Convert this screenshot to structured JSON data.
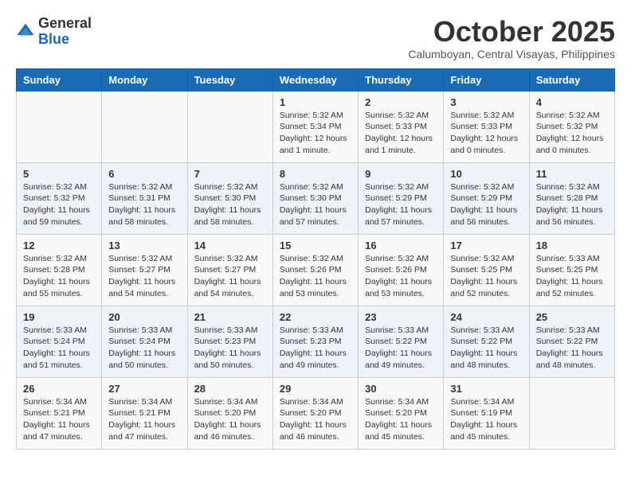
{
  "logo": {
    "general": "General",
    "blue": "Blue"
  },
  "header": {
    "month": "October 2025",
    "location": "Calumboyan, Central Visayas, Philippines"
  },
  "days_of_week": [
    "Sunday",
    "Monday",
    "Tuesday",
    "Wednesday",
    "Thursday",
    "Friday",
    "Saturday"
  ],
  "weeks": [
    [
      {
        "day": "",
        "content": ""
      },
      {
        "day": "",
        "content": ""
      },
      {
        "day": "",
        "content": ""
      },
      {
        "day": "1",
        "content": "Sunrise: 5:32 AM\nSunset: 5:34 PM\nDaylight: 12 hours\nand 1 minute."
      },
      {
        "day": "2",
        "content": "Sunrise: 5:32 AM\nSunset: 5:33 PM\nDaylight: 12 hours\nand 1 minute."
      },
      {
        "day": "3",
        "content": "Sunrise: 5:32 AM\nSunset: 5:33 PM\nDaylight: 12 hours\nand 0 minutes."
      },
      {
        "day": "4",
        "content": "Sunrise: 5:32 AM\nSunset: 5:32 PM\nDaylight: 12 hours\nand 0 minutes."
      }
    ],
    [
      {
        "day": "5",
        "content": "Sunrise: 5:32 AM\nSunset: 5:32 PM\nDaylight: 11 hours\nand 59 minutes."
      },
      {
        "day": "6",
        "content": "Sunrise: 5:32 AM\nSunset: 5:31 PM\nDaylight: 11 hours\nand 58 minutes."
      },
      {
        "day": "7",
        "content": "Sunrise: 5:32 AM\nSunset: 5:30 PM\nDaylight: 11 hours\nand 58 minutes."
      },
      {
        "day": "8",
        "content": "Sunrise: 5:32 AM\nSunset: 5:30 PM\nDaylight: 11 hours\nand 57 minutes."
      },
      {
        "day": "9",
        "content": "Sunrise: 5:32 AM\nSunset: 5:29 PM\nDaylight: 11 hours\nand 57 minutes."
      },
      {
        "day": "10",
        "content": "Sunrise: 5:32 AM\nSunset: 5:29 PM\nDaylight: 11 hours\nand 56 minutes."
      },
      {
        "day": "11",
        "content": "Sunrise: 5:32 AM\nSunset: 5:28 PM\nDaylight: 11 hours\nand 56 minutes."
      }
    ],
    [
      {
        "day": "12",
        "content": "Sunrise: 5:32 AM\nSunset: 5:28 PM\nDaylight: 11 hours\nand 55 minutes."
      },
      {
        "day": "13",
        "content": "Sunrise: 5:32 AM\nSunset: 5:27 PM\nDaylight: 11 hours\nand 54 minutes."
      },
      {
        "day": "14",
        "content": "Sunrise: 5:32 AM\nSunset: 5:27 PM\nDaylight: 11 hours\nand 54 minutes."
      },
      {
        "day": "15",
        "content": "Sunrise: 5:32 AM\nSunset: 5:26 PM\nDaylight: 11 hours\nand 53 minutes."
      },
      {
        "day": "16",
        "content": "Sunrise: 5:32 AM\nSunset: 5:26 PM\nDaylight: 11 hours\nand 53 minutes."
      },
      {
        "day": "17",
        "content": "Sunrise: 5:32 AM\nSunset: 5:25 PM\nDaylight: 11 hours\nand 52 minutes."
      },
      {
        "day": "18",
        "content": "Sunrise: 5:33 AM\nSunset: 5:25 PM\nDaylight: 11 hours\nand 52 minutes."
      }
    ],
    [
      {
        "day": "19",
        "content": "Sunrise: 5:33 AM\nSunset: 5:24 PM\nDaylight: 11 hours\nand 51 minutes."
      },
      {
        "day": "20",
        "content": "Sunrise: 5:33 AM\nSunset: 5:24 PM\nDaylight: 11 hours\nand 50 minutes."
      },
      {
        "day": "21",
        "content": "Sunrise: 5:33 AM\nSunset: 5:23 PM\nDaylight: 11 hours\nand 50 minutes."
      },
      {
        "day": "22",
        "content": "Sunrise: 5:33 AM\nSunset: 5:23 PM\nDaylight: 11 hours\nand 49 minutes."
      },
      {
        "day": "23",
        "content": "Sunrise: 5:33 AM\nSunset: 5:22 PM\nDaylight: 11 hours\nand 49 minutes."
      },
      {
        "day": "24",
        "content": "Sunrise: 5:33 AM\nSunset: 5:22 PM\nDaylight: 11 hours\nand 48 minutes."
      },
      {
        "day": "25",
        "content": "Sunrise: 5:33 AM\nSunset: 5:22 PM\nDaylight: 11 hours\nand 48 minutes."
      }
    ],
    [
      {
        "day": "26",
        "content": "Sunrise: 5:34 AM\nSunset: 5:21 PM\nDaylight: 11 hours\nand 47 minutes."
      },
      {
        "day": "27",
        "content": "Sunrise: 5:34 AM\nSunset: 5:21 PM\nDaylight: 11 hours\nand 47 minutes."
      },
      {
        "day": "28",
        "content": "Sunrise: 5:34 AM\nSunset: 5:20 PM\nDaylight: 11 hours\nand 46 minutes."
      },
      {
        "day": "29",
        "content": "Sunrise: 5:34 AM\nSunset: 5:20 PM\nDaylight: 11 hours\nand 46 minutes."
      },
      {
        "day": "30",
        "content": "Sunrise: 5:34 AM\nSunset: 5:20 PM\nDaylight: 11 hours\nand 45 minutes."
      },
      {
        "day": "31",
        "content": "Sunrise: 5:34 AM\nSunset: 5:19 PM\nDaylight: 11 hours\nand 45 minutes."
      },
      {
        "day": "",
        "content": ""
      }
    ]
  ]
}
